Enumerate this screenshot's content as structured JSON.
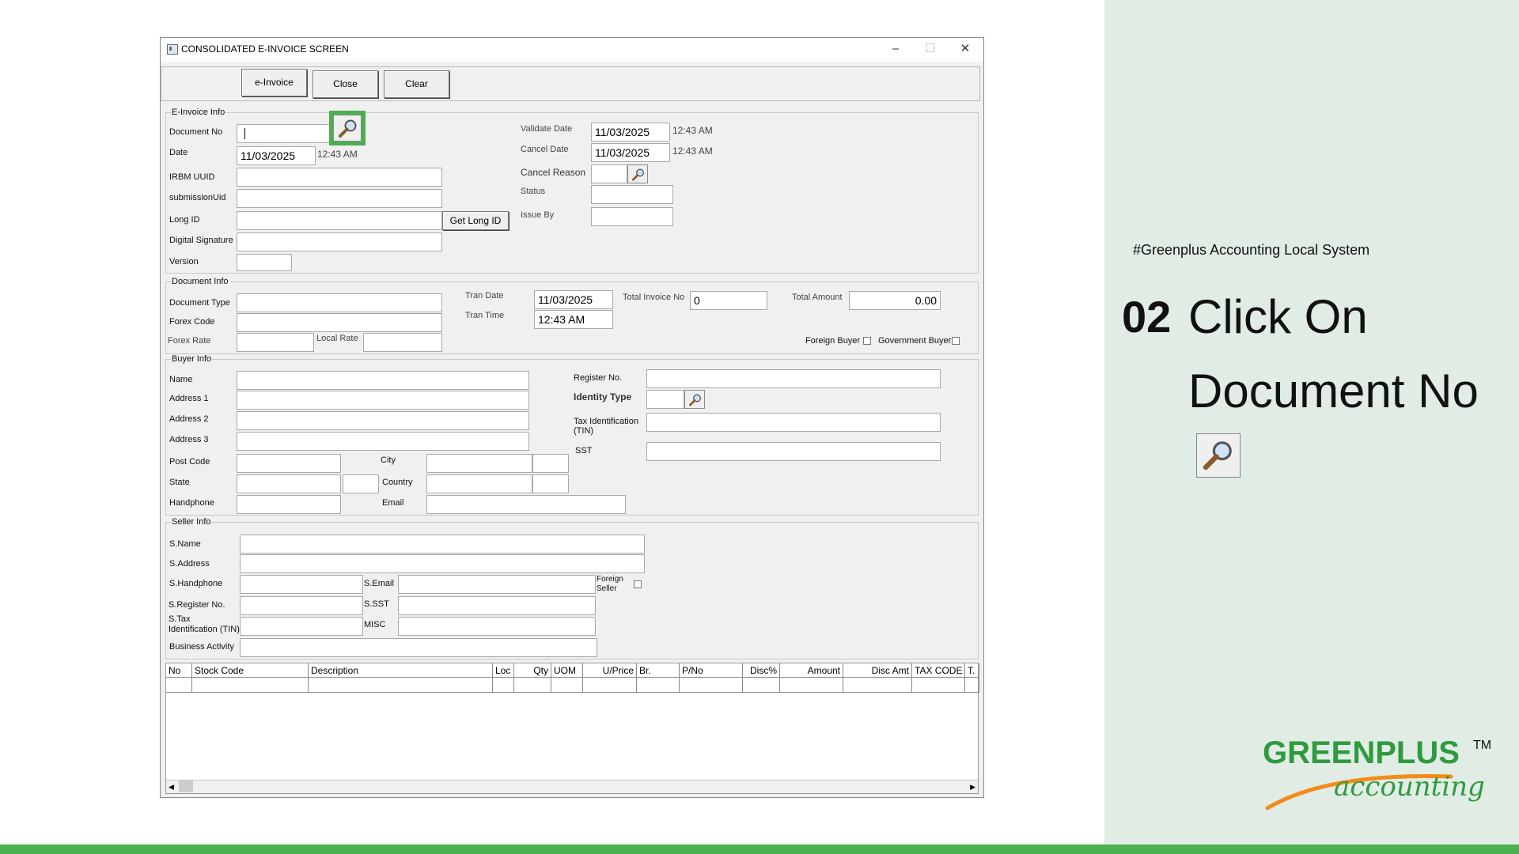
{
  "window": {
    "title": "CONSOLIDATED E-INVOICE SCREEN",
    "minimize": "–",
    "maximize": "☐",
    "close": "✕"
  },
  "toolbar": {
    "einvoice": "e-Invoice",
    "close": "Close",
    "clear": "Clear"
  },
  "einvoice_info": {
    "legend": "E-Invoice Info",
    "document_no": {
      "label": "Document No",
      "value": ""
    },
    "date": {
      "label": "Date",
      "value": "11/03/2025",
      "time": "12:43 AM"
    },
    "irbm_uuid": {
      "label": "IRBM UUID",
      "value": ""
    },
    "submission_uid": {
      "label": "submissionUid",
      "value": ""
    },
    "long_id": {
      "label": "Long ID",
      "value": "",
      "button": "Get Long ID"
    },
    "digital_signature": {
      "label": "Digital Signature",
      "value": ""
    },
    "version": {
      "label": "Version",
      "value": ""
    },
    "validate_date": {
      "label": "Validate Date",
      "value": "11/03/2025",
      "time": "12:43 AM"
    },
    "cancel_date": {
      "label": "Cancel Date",
      "value": "11/03/2025",
      "time": "12:43 AM"
    },
    "cancel_reason": {
      "label": "Cancel Reason",
      "value": ""
    },
    "status": {
      "label": "Status",
      "value": ""
    },
    "issue_by": {
      "label": "Issue By",
      "value": ""
    }
  },
  "document_info": {
    "legend": "Document Info",
    "document_type": {
      "label": "Document Type",
      "value": ""
    },
    "forex_code": {
      "label": "Forex Code",
      "value": ""
    },
    "forex_rate": {
      "label": "Forex Rate",
      "value": ""
    },
    "local_rate": {
      "label": "Local Rate",
      "value": ""
    },
    "tran_date": {
      "label": "Tran Date",
      "value": "11/03/2025"
    },
    "tran_time": {
      "label": "Tran Time",
      "value": "12:43 AM"
    },
    "total_invoice_no": {
      "label": "Total Invoice No",
      "value": "0"
    },
    "total_amount": {
      "label": "Total Amount",
      "value": "0.00"
    },
    "foreign_buyer": "Foreign Buyer",
    "government_buyer": "Government Buyer"
  },
  "buyer_info": {
    "legend": "Buyer Info",
    "name": "Name",
    "address1": "Address 1",
    "address2": "Address 2",
    "address3": "Address 3",
    "post_code": "Post Code",
    "city": "City",
    "state": "State",
    "country": "Country",
    "handphone": "Handphone",
    "email": "Email",
    "register_no": "Register No.",
    "identity_type": "Identity Type",
    "tin_line1": "Tax Identification",
    "tin_line2": "(TIN)",
    "sst": "SST"
  },
  "seller_info": {
    "legend": "Seller Info",
    "name": "S.Name",
    "address": "S.Address",
    "handphone": "S.Handphone",
    "email": "S.Email",
    "foreign_seller_1": "Foreign",
    "foreign_seller_2": "Seller",
    "register_no": "S.Register No.",
    "sst": "S.SST",
    "tin_line1": "S.Tax",
    "tin_line2": "Identification (TIN)",
    "misc": "MISC",
    "business_activity": "Business Activity"
  },
  "grid": {
    "columns": [
      "No",
      "Stock Code",
      "Description",
      "Loc",
      "Qty",
      "UOM",
      "U/Price",
      "Br.",
      "P/No",
      "Disc%",
      "Amount",
      "Disc Amt",
      "TAX CODE",
      "T."
    ]
  },
  "tutorial": {
    "hashtag": "#Greenplus Accounting Local System",
    "step_number": "02",
    "step_line1": "Click On",
    "step_line2": "Document No"
  },
  "logo": {
    "brand": "GREENPLUS",
    "tm": "TM",
    "tagline": "accounting"
  },
  "colors": {
    "highlight": "#4caf50",
    "right_bg": "#e1ece5",
    "brand_green": "#2e9b3e",
    "brand_orange": "#f28c1a"
  }
}
